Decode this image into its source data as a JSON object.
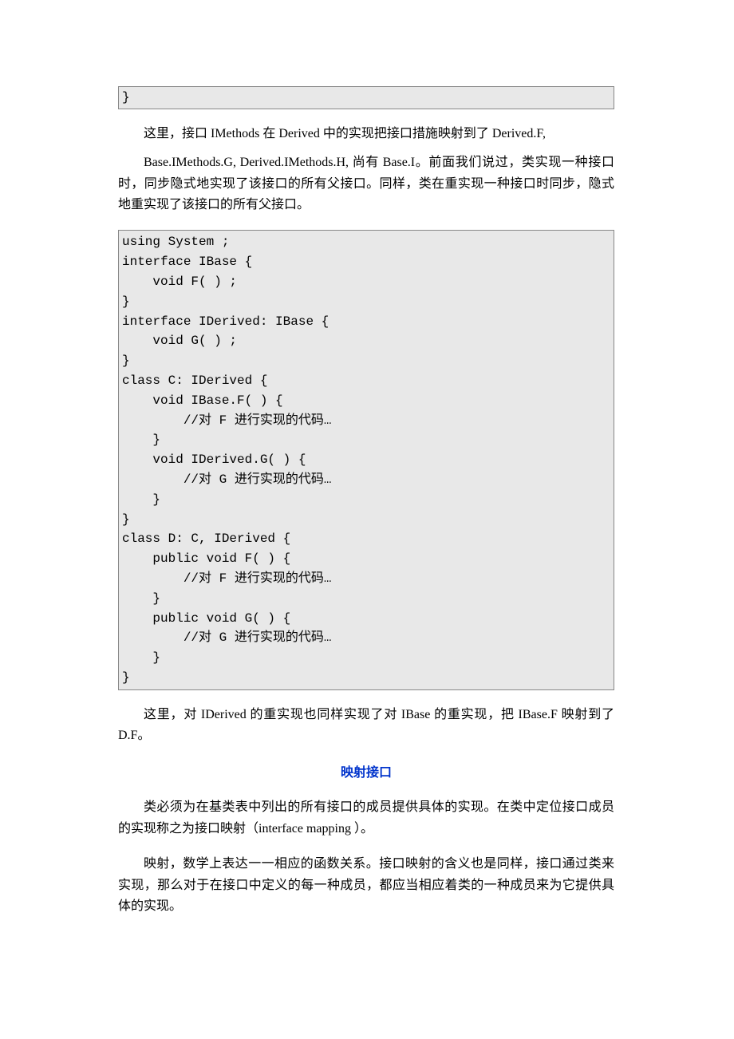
{
  "code1": "}",
  "para1": "这里，接口 IMethods 在 Derived 中的实现把接口措施映射到了 Derived.F,",
  "para2": "Base.IMethods.G, Derived.IMethods.H, 尚有 Base.I。前面我们说过，类实现一种接口时，同步隐式地实现了该接口的所有父接口。同样，类在重实现一种接口时同步，隐式地重实现了该接口的所有父接口。",
  "code2": "using System ;\ninterface IBase {\n    void F( ) ;\n}\ninterface IDerived: IBase {\n    void G( ) ;\n}\nclass C: IDerived {\n    void IBase.F( ) {\n        //对 F 进行实现的代码…\n    }\n    void IDerived.G( ) {\n        //对 G 进行实现的代码…\n    }\n}\nclass D: C, IDerived {\n    public void F( ) {\n        //对 F 进行实现的代码…\n    }\n    public void G( ) {\n        //对 G 进行实现的代码…\n    }\n}",
  "para3": "这里，对 IDerived 的重实现也同样实现了对 IBase 的重实现，把 IBase.F 映射到了 D.F。",
  "heading1": "映射接口",
  "para4": "类必须为在基类表中列出的所有接口的成员提供具体的实现。在类中定位接口成员的实现称之为接口映射（interface mapping ）。",
  "para5": "映射，数学上表达一一相应的函数关系。接口映射的含义也是同样，接口通过类来实现，那么对于在接口中定义的每一种成员，都应当相应着类的一种成员来为它提供具体的实现。"
}
